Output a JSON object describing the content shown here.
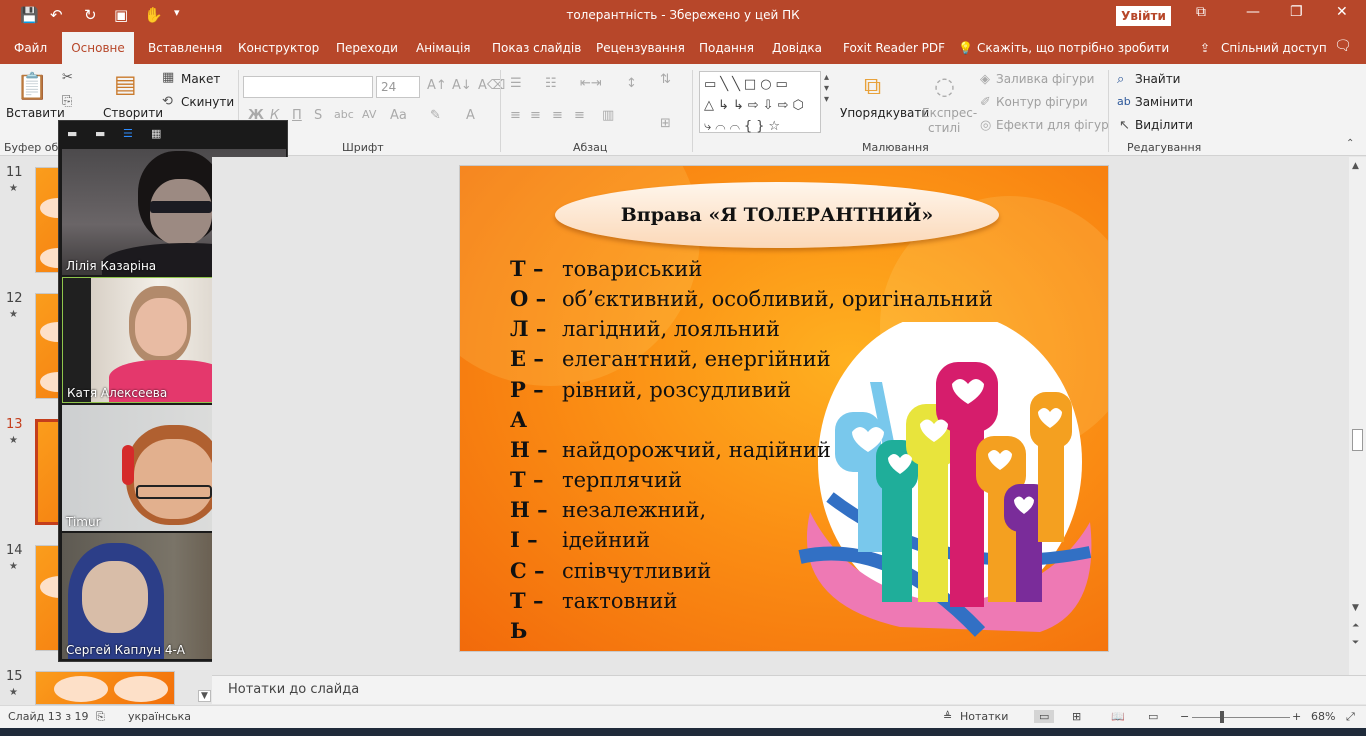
{
  "titlebar": {
    "title": "толерантність  -  Збережено у цей ПК",
    "signin": "Увійти"
  },
  "menu": {
    "items": [
      "Файл",
      "Основне",
      "Вставлення",
      "Конструктор",
      "Переходи",
      "Анімація",
      "Показ слайдів",
      "Рецензування",
      "Подання",
      "Довідка",
      "Foxit Reader PDF"
    ],
    "tell_me": "Скажіть, що потрібно зробити",
    "share": "Спільний доступ"
  },
  "ribbon": {
    "paste": "Вставити",
    "clipboard": "Буфер обміну",
    "create": "Створити",
    "layout": "Макет",
    "reset": "Скинути",
    "font_size": "24",
    "font_group": "Шрифт",
    "paragraph_group": "Абзац",
    "arrange": "Упорядкувати",
    "quick_styles_1": "Експрес-",
    "quick_styles_2": "стилі",
    "fill": "Заливка фігури",
    "outline": "Контур фігури",
    "effects": "Ефекти для фігур",
    "drawing_group": "Малювання",
    "find": "Знайти",
    "replace": "Замінити",
    "select": "Виділити",
    "editing_group": "Редагування"
  },
  "thumbnails": [
    {
      "num": "11"
    },
    {
      "num": "12"
    },
    {
      "num": "13"
    },
    {
      "num": "14"
    },
    {
      "num": "15"
    }
  ],
  "participants": [
    {
      "name": "Лілія Казаріна"
    },
    {
      "name": "Катя Алексеева"
    },
    {
      "name": "Timur"
    },
    {
      "name": "Сергей Каплун 4-А"
    }
  ],
  "slide": {
    "title": "Вправа «Я ТОЛЕРАНТНИЙ»",
    "lines": [
      {
        "letter": "Т –",
        "text": "товариський"
      },
      {
        "letter": "О –",
        "text": "об’єктивний, особливий, оригінальний"
      },
      {
        "letter": "Л –",
        "text": "лагідний, лояльний"
      },
      {
        "letter": "Е –",
        "text": "елегантний, енергійний"
      },
      {
        "letter": "Р –",
        "text": "рівний, розсудливий"
      },
      {
        "letter": "А",
        "text": ""
      },
      {
        "letter": "Н –",
        "text": "найдорожчий, надійний"
      },
      {
        "letter": "Т –",
        "text": "терплячий"
      },
      {
        "letter": "Н –",
        "text": "незалежний,"
      },
      {
        "letter": "І –",
        "text": "ідейний"
      },
      {
        "letter": "С –",
        "text": "співчутливий"
      },
      {
        "letter": "Т –",
        "text": "тактовний"
      },
      {
        "letter": "Ь",
        "text": ""
      }
    ]
  },
  "notes": {
    "label": "Нотатки до слайда"
  },
  "status": {
    "slide": "Слайд 13 з 19",
    "lang": "українська",
    "notes": "Нотатки",
    "zoom": "68%"
  },
  "colors": {
    "accent": "#b7472a",
    "slide_orange": "#f8861a"
  }
}
